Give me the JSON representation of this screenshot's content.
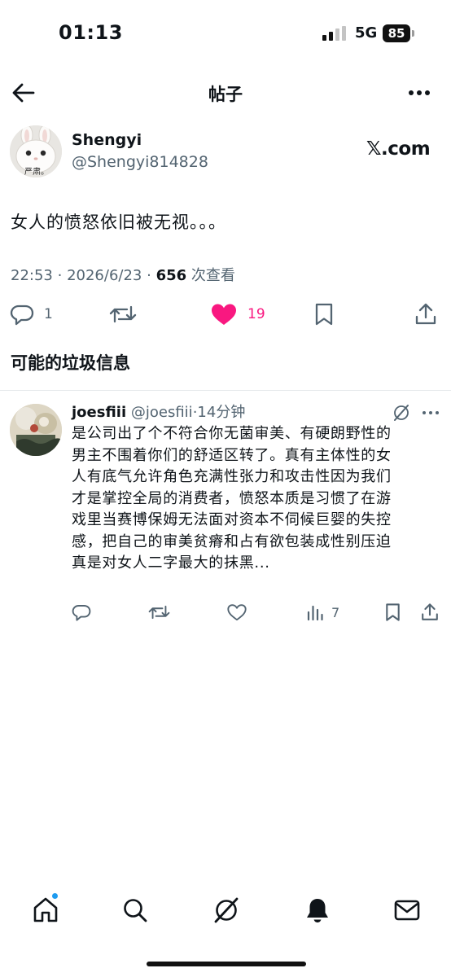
{
  "status_bar": {
    "time": "01:13",
    "network": "5G",
    "battery": "85"
  },
  "header": {
    "title": "帖子",
    "back_icon": "arrow-left-icon",
    "more_icon": "more-horizontal-icon"
  },
  "post": {
    "author_name": "Shengyi",
    "author_handle": "@Shengyi814828",
    "source_logo": "𝕏.com",
    "avatar_caption": "严肃。",
    "text": "女人的愤怒依旧被无视。。。",
    "time": "22:53",
    "separator": "·",
    "date": "2026/6/23",
    "views_count": "656",
    "views_label": "次查看",
    "actions": {
      "replies": "1",
      "reposts": "",
      "likes": "19",
      "liked": true,
      "like_color": "#f91880"
    }
  },
  "section_title": "可能的垃圾信息",
  "reply": {
    "name": "joesfiii",
    "handle": "@joesfiii",
    "separator": "·",
    "time": "14分钟",
    "lines": [
      "是公司出了个不符合你无菌审美、有硬朗野性的",
      "男主不围着你们的舒适区转了。真有主体性的女",
      "人有底气允许角色充满性张力和攻击性因为我们",
      "才是掌控全局的消费者，愤怒本质是习惯了在游",
      "戏里当赛博保姆无法面对资本不伺候巨婴的失控",
      "感，把自己的审美贫瘠和占有欲包装成性别压迫",
      "真是对女人二字最大的抹黑..."
    ],
    "views": "7"
  },
  "bottom_nav": {
    "items": [
      "home-icon",
      "search-icon",
      "grok-icon",
      "notifications-bell-icon",
      "messages-envelope-icon"
    ],
    "home_notification_dot": true,
    "accent": "#1d9bf0"
  }
}
